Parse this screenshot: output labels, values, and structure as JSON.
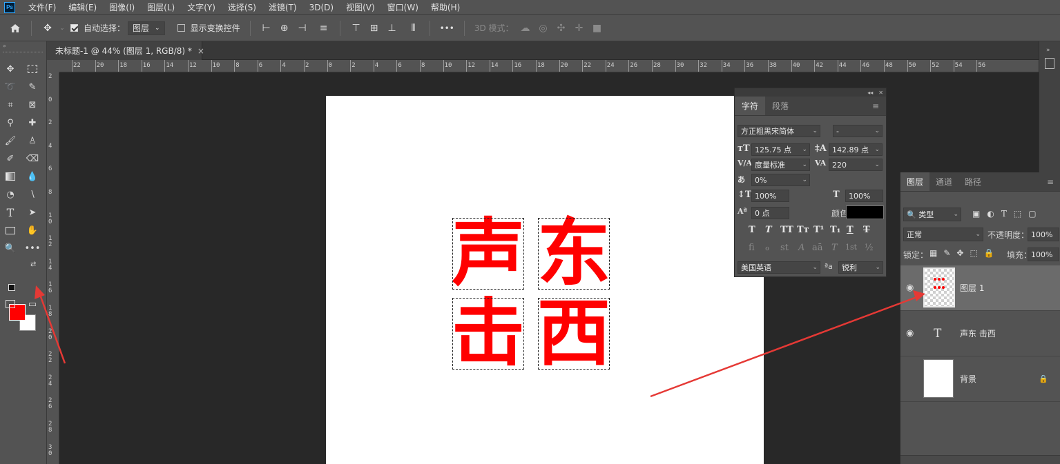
{
  "app": {
    "logo": "Ps"
  },
  "menu": [
    "文件(F)",
    "编辑(E)",
    "图像(I)",
    "图层(L)",
    "文字(Y)",
    "选择(S)",
    "滤镜(T)",
    "3D(D)",
    "视图(V)",
    "窗口(W)",
    "帮助(H)"
  ],
  "options": {
    "auto_select_label": "自动选择：",
    "auto_select_value": "图层",
    "transform_label": "显示变换控件",
    "mode3d_label": "3D 模式：",
    "more": "•••"
  },
  "document": {
    "tab_title": "未标题-1 @ 44% (图层 1, RGB/8) *",
    "close": "×"
  },
  "ruler": {
    "h_labels": [
      "22",
      "20",
      "18",
      "16",
      "14",
      "12",
      "10",
      "8",
      "6",
      "4",
      "2",
      "0",
      "2",
      "4",
      "6",
      "8",
      "10",
      "12",
      "14",
      "16",
      "18",
      "20",
      "22",
      "24",
      "26",
      "28",
      "30",
      "32",
      "34",
      "36",
      "38",
      "40",
      "42",
      "44",
      "46",
      "48",
      "50",
      "52",
      "54",
      "56"
    ],
    "v_labels": [
      "2",
      "0",
      "2",
      "4",
      "6",
      "8",
      "1\n0",
      "1\n2",
      "1\n4",
      "1\n6",
      "1\n8",
      "2\n0",
      "2\n2",
      "2\n4",
      "2\n6",
      "2\n8",
      "3\n0"
    ]
  },
  "canvas_text": {
    "c1": "声",
    "c2": "东",
    "c3": "击",
    "c4": "西"
  },
  "char_panel": {
    "tabs": [
      "字符",
      "段落"
    ],
    "font_family": "方正粗黑宋简体",
    "font_style": "-",
    "font_size": "125.75 点",
    "leading": "142.89 点",
    "kerning": "度量标准",
    "tracking": "220",
    "tsume": "0%",
    "vscale": "100%",
    "hscale": "100%",
    "baseline": "0 点",
    "color_label": "颜色：",
    "styles": [
      "T",
      "T",
      "TT",
      "Tт",
      "T¹",
      "T₁",
      "T",
      "T"
    ],
    "opentype": [
      "fi",
      "ℴ",
      "st",
      "A",
      "aā",
      "T",
      "1st",
      "½"
    ],
    "language": "美国英语",
    "aa_label": "ªa",
    "antialias": "锐利",
    "text_color": "#000000"
  },
  "layers_panel": {
    "tabs": [
      "图层",
      "通道",
      "路径"
    ],
    "filter": "类型",
    "blend_mode": "正常",
    "opacity_label": "不透明度：",
    "opacity": "100%",
    "lock_label": "锁定：",
    "fill_label": "填充：",
    "fill": "100%",
    "layers": [
      {
        "name": "图层 1",
        "selected": true
      },
      {
        "name": "声东 击西",
        "type_icon": "T"
      },
      {
        "name": "背景",
        "lock": "🔒"
      }
    ]
  },
  "colors": {
    "foreground": "#ff0000",
    "background": "#ffffff",
    "arrow": "#e53935"
  }
}
